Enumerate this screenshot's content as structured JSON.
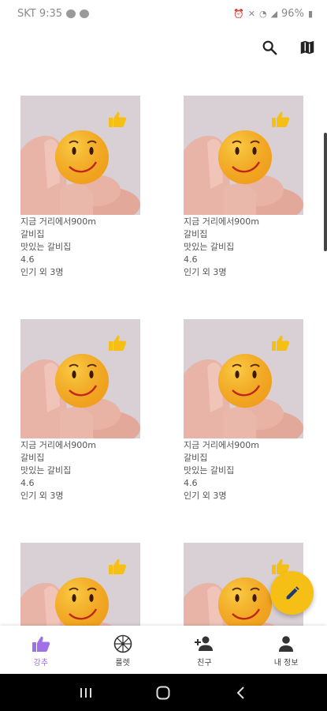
{
  "status": {
    "carrier_time": "SKT 9:35",
    "battery": "96%"
  },
  "colors": {
    "accent": "#a070e8",
    "fab": "#f6bf16",
    "like": "#f6bf16"
  },
  "toolbar": {
    "search_icon": "search-icon",
    "map_icon": "map-icon"
  },
  "cards": [
    {
      "distance": "지금 거리에서900m",
      "category": "갈비집",
      "name": "맛있는 갈비집",
      "rating": "4.6",
      "likes": "인기 외 3명"
    },
    {
      "distance": "지금 거리에서900m",
      "category": "갈비집",
      "name": "맛있는 갈비집",
      "rating": "4.6",
      "likes": "인기 외 3명"
    },
    {
      "distance": "지금 거리에서900m",
      "category": "갈비집",
      "name": "맛있는 갈비집",
      "rating": "4.6",
      "likes": "인기 외 3명"
    },
    {
      "distance": "지금 거리에서900m",
      "category": "갈비집",
      "name": "맛있는 갈비집",
      "rating": "4.6",
      "likes": "인기 외 3명"
    },
    {
      "distance": "",
      "category": "",
      "name": "",
      "rating": "",
      "likes": ""
    },
    {
      "distance": "",
      "category": "",
      "name": "",
      "rating": "",
      "likes": ""
    }
  ],
  "fab": {
    "icon": "pencil-icon"
  },
  "bottom_nav": [
    {
      "label": "강추",
      "icon": "thumbs-up-icon",
      "active": true
    },
    {
      "label": "룰렛",
      "icon": "roulette-wheel-icon",
      "active": false
    },
    {
      "label": "친구",
      "icon": "add-friend-icon",
      "active": false
    },
    {
      "label": "내 정보",
      "icon": "person-icon",
      "active": false
    }
  ]
}
